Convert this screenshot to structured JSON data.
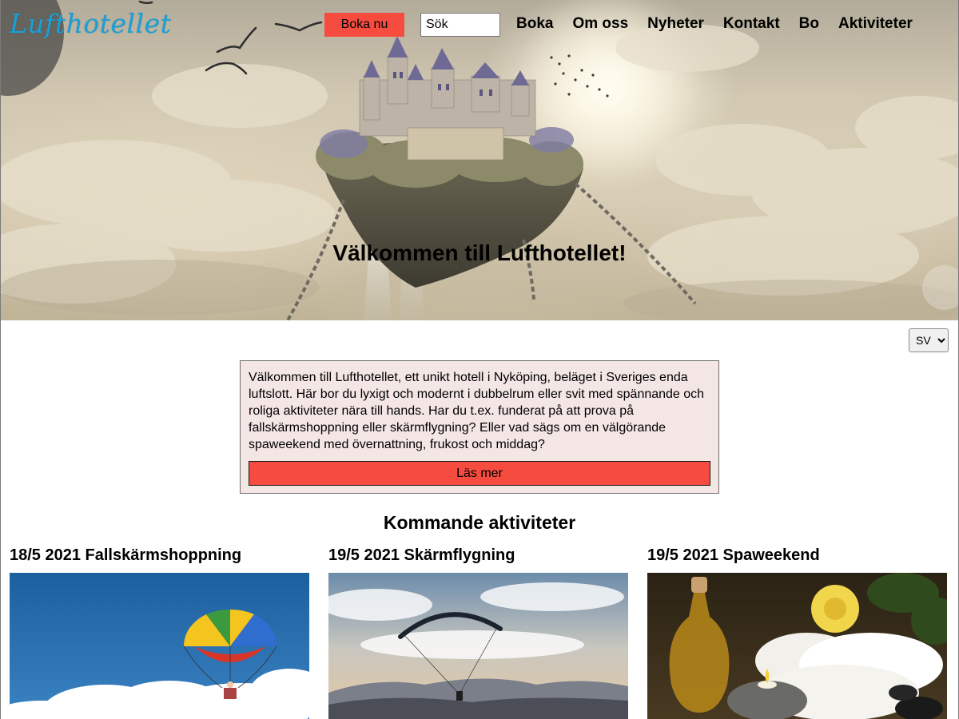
{
  "header": {
    "logo": "Lufthotellet",
    "book_button": "Boka nu",
    "search_placeholder": "Sök",
    "nav": [
      "Boka",
      "Om oss",
      "Nyheter",
      "Kontakt",
      "Bo",
      "Aktiviteter"
    ]
  },
  "hero": {
    "heading": "Välkommen till Lufthotellet!"
  },
  "language": {
    "selected": "SV"
  },
  "intro": {
    "text": "Välkommen till Lufthotellet, ett unikt hotell i Nyköping, beläget i Sveriges enda luftslott. Här bor du lyxigt och modernt i dubbelrum eller svit med spännande och roliga aktiviteter nära till hands. Har du t.ex. funderat på att prova på fallskärmshoppning eller skärmflygning? Eller vad sägs om en välgörande spaweekend med övernattning, frukost och middag?",
    "read_more": "Läs mer"
  },
  "activities": {
    "heading": "Kommande aktiviteter",
    "items": [
      {
        "title": "18/5 2021 Fallskärmshoppning"
      },
      {
        "title": "19/5 2021 Skärmflygning"
      },
      {
        "title": "19/5 2021 Spaweekend"
      }
    ]
  },
  "colors": {
    "accent": "#f64c3f",
    "logo": "#19a0d8",
    "intro_background": "#f5e6e6"
  }
}
